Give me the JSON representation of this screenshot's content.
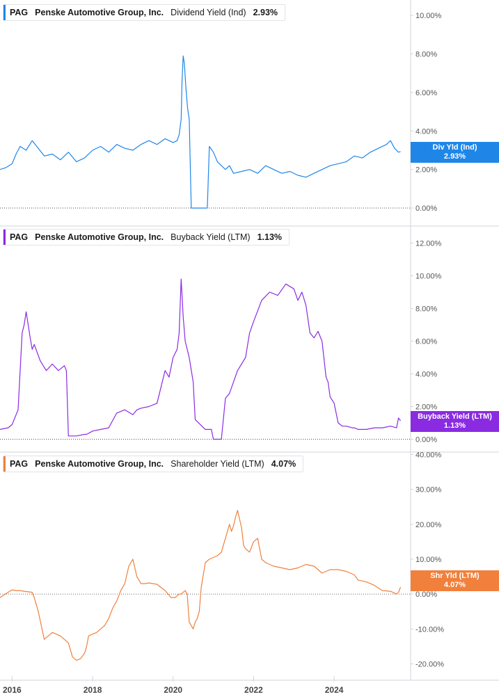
{
  "colors": {
    "dividend": "#1f86e8",
    "buyback": "#8a2be2",
    "shareholder": "#f0803c",
    "axis_text": "#555555",
    "divider": "#d0d3d9"
  },
  "x_axis": {
    "range": [
      2015.7,
      2025.9
    ],
    "ticks": [
      {
        "value": 2016,
        "label": "2016"
      },
      {
        "value": 2018,
        "label": "2018"
      },
      {
        "value": 2020,
        "label": "2020"
      },
      {
        "value": 2022,
        "label": "2022"
      },
      {
        "value": 2024,
        "label": "2024"
      }
    ]
  },
  "chart_data": [
    {
      "type": "line",
      "ticker": "PAG",
      "company": "Penske Automotive Group, Inc.",
      "metric": "Dividend Yield (Ind)",
      "current_value": "2.93%",
      "badge_label": "Div Yld (Ind)",
      "color": "#1f86e8",
      "ylim": [
        -0.9,
        10.8
      ],
      "y_ticks": [
        {
          "value": 0,
          "label": "0.00%"
        },
        {
          "value": 2,
          "label": "2.00%"
        },
        {
          "value": 4,
          "label": "4.00%"
        },
        {
          "value": 6,
          "label": "6.00%"
        },
        {
          "value": 8,
          "label": "8.00%"
        },
        {
          "value": 10,
          "label": "10.00%"
        }
      ],
      "x": [
        2015.7,
        2015.85,
        2016.0,
        2016.1,
        2016.2,
        2016.35,
        2016.5,
        2016.65,
        2016.8,
        2017.0,
        2017.2,
        2017.4,
        2017.6,
        2017.8,
        2018.0,
        2018.2,
        2018.4,
        2018.6,
        2018.8,
        2019.0,
        2019.2,
        2019.4,
        2019.6,
        2019.8,
        2020.0,
        2020.1,
        2020.15,
        2020.2,
        2020.22,
        2020.25,
        2020.28,
        2020.32,
        2020.36,
        2020.4,
        2020.45,
        2020.5,
        2020.55,
        2020.6,
        2020.65,
        2020.7,
        2020.75,
        2020.8,
        2020.85,
        2020.9,
        2021.0,
        2021.1,
        2021.2,
        2021.3,
        2021.4,
        2021.5,
        2021.7,
        2021.9,
        2022.1,
        2022.3,
        2022.5,
        2022.7,
        2022.9,
        2023.1,
        2023.3,
        2023.5,
        2023.7,
        2023.9,
        2024.1,
        2024.3,
        2024.5,
        2024.7,
        2024.9,
        2025.1,
        2025.3,
        2025.4,
        2025.5,
        2025.6,
        2025.65
      ],
      "y": [
        2.0,
        2.1,
        2.3,
        2.8,
        3.2,
        3.0,
        3.5,
        3.1,
        2.7,
        2.8,
        2.5,
        2.9,
        2.4,
        2.6,
        3.0,
        3.2,
        2.9,
        3.3,
        3.1,
        3.0,
        3.3,
        3.5,
        3.3,
        3.6,
        3.4,
        3.5,
        3.8,
        4.6,
        6.5,
        7.9,
        7.5,
        6.2,
        5.2,
        4.6,
        0.0,
        0.0,
        0.0,
        0.0,
        0.0,
        0.0,
        0.0,
        0.0,
        0.0,
        3.2,
        2.9,
        2.4,
        2.2,
        2.0,
        2.2,
        1.8,
        1.9,
        2.0,
        1.8,
        2.2,
        2.0,
        1.8,
        1.9,
        1.7,
        1.6,
        1.8,
        2.0,
        2.2,
        2.3,
        2.4,
        2.7,
        2.6,
        2.9,
        3.1,
        3.3,
        3.5,
        3.1,
        2.9,
        2.93
      ]
    },
    {
      "type": "line",
      "ticker": "PAG",
      "company": "Penske Automotive Group, Inc.",
      "metric": "Buyback Yield (LTM)",
      "current_value": "1.13%",
      "badge_label": "Buyback Yield (LTM)",
      "color": "#8a2be2",
      "ylim": [
        -0.7,
        13.0
      ],
      "y_ticks": [
        {
          "value": 0,
          "label": "0.00%"
        },
        {
          "value": 2,
          "label": "2.00%"
        },
        {
          "value": 4,
          "label": "4.00%"
        },
        {
          "value": 6,
          "label": "6.00%"
        },
        {
          "value": 8,
          "label": "8.00%"
        },
        {
          "value": 10,
          "label": "10.00%"
        },
        {
          "value": 12,
          "label": "12.00%"
        }
      ],
      "x": [
        2015.7,
        2015.9,
        2016.0,
        2016.1,
        2016.15,
        2016.25,
        2016.3,
        2016.35,
        2016.45,
        2016.5,
        2016.55,
        2016.7,
        2016.85,
        2017.0,
        2017.15,
        2017.3,
        2017.35,
        2017.4,
        2017.6,
        2017.8,
        2017.85,
        2018.0,
        2018.2,
        2018.4,
        2018.6,
        2018.8,
        2019.0,
        2019.1,
        2019.2,
        2019.4,
        2019.6,
        2019.8,
        2019.9,
        2020.0,
        2020.1,
        2020.15,
        2020.2,
        2020.25,
        2020.3,
        2020.4,
        2020.5,
        2020.55,
        2020.8,
        2020.9,
        2020.95,
        2021.0,
        2021.2,
        2021.3,
        2021.4,
        2021.5,
        2021.6,
        2021.8,
        2021.9,
        2022.0,
        2022.2,
        2022.4,
        2022.6,
        2022.8,
        2023.0,
        2023.1,
        2023.2,
        2023.3,
        2023.4,
        2023.5,
        2023.6,
        2023.7,
        2023.8,
        2023.85,
        2023.9,
        2024.0,
        2024.1,
        2024.2,
        2024.3,
        2024.45,
        2024.5,
        2024.6,
        2024.8,
        2025.0,
        2025.2,
        2025.4,
        2025.55,
        2025.6,
        2025.65
      ],
      "y": [
        0.6,
        0.7,
        0.9,
        1.5,
        1.8,
        6.5,
        7.0,
        7.8,
        6.2,
        5.5,
        5.8,
        4.8,
        4.2,
        4.6,
        4.2,
        4.5,
        4.2,
        0.2,
        0.2,
        0.3,
        0.3,
        0.5,
        0.6,
        0.7,
        1.6,
        1.8,
        1.5,
        1.8,
        1.9,
        2.0,
        2.2,
        4.2,
        3.8,
        5.0,
        5.5,
        6.5,
        9.8,
        7.5,
        6.0,
        5.0,
        3.5,
        1.2,
        0.6,
        0.6,
        0.6,
        0.0,
        0.0,
        2.5,
        2.8,
        3.5,
        4.2,
        5.0,
        6.5,
        7.2,
        8.5,
        9.0,
        8.8,
        9.5,
        9.2,
        8.5,
        9.0,
        8.2,
        6.5,
        6.2,
        6.6,
        6.0,
        3.8,
        3.5,
        2.6,
        2.2,
        1.0,
        0.8,
        0.8,
        0.7,
        0.7,
        0.6,
        0.6,
        0.7,
        0.7,
        0.8,
        0.7,
        1.3,
        1.13
      ]
    },
    {
      "type": "line",
      "ticker": "PAG",
      "company": "Penske Automotive Group, Inc.",
      "metric": "Shareholder Yield (LTM)",
      "current_value": "4.07%",
      "badge_label": "Shr Yld (LTM)",
      "color": "#f0803c",
      "ylim": [
        -23.5,
        40.5
      ],
      "y_ticks": [
        {
          "value": -20,
          "label": "-20.00%"
        },
        {
          "value": -10,
          "label": "-10.00%"
        },
        {
          "value": 0,
          "label": "0.00%"
        },
        {
          "value": 10,
          "label": "10.00%"
        },
        {
          "value": 20,
          "label": "20.00%"
        },
        {
          "value": 30,
          "label": "30.00%"
        },
        {
          "value": 40,
          "label": "40.00%"
        }
      ],
      "x": [
        2015.7,
        2015.9,
        2016.0,
        2016.1,
        2016.2,
        2016.3,
        2016.5,
        2016.55,
        2016.65,
        2016.8,
        2016.9,
        2017.0,
        2017.1,
        2017.2,
        2017.3,
        2017.4,
        2017.5,
        2017.6,
        2017.7,
        2017.8,
        2017.85,
        2017.9,
        2018.0,
        2018.1,
        2018.2,
        2018.3,
        2018.4,
        2018.5,
        2018.6,
        2018.7,
        2018.8,
        2018.9,
        2019.0,
        2019.1,
        2019.2,
        2019.3,
        2019.4,
        2019.5,
        2019.6,
        2019.8,
        2019.95,
        2020.0,
        2020.05,
        2020.1,
        2020.15,
        2020.2,
        2020.25,
        2020.3,
        2020.35,
        2020.4,
        2020.5,
        2020.55,
        2020.6,
        2020.65,
        2020.7,
        2020.8,
        2020.9,
        2021.0,
        2021.1,
        2021.2,
        2021.3,
        2021.4,
        2021.45,
        2021.5,
        2021.55,
        2021.6,
        2021.7,
        2021.75,
        2021.8,
        2021.9,
        2022.0,
        2022.1,
        2022.2,
        2022.3,
        2022.5,
        2022.7,
        2022.9,
        2023.1,
        2023.3,
        2023.5,
        2023.7,
        2023.9,
        2024.1,
        2024.3,
        2024.5,
        2024.6,
        2024.8,
        2025.0,
        2025.2,
        2025.4,
        2025.55,
        2025.6,
        2025.65
      ],
      "y": [
        -1.0,
        0.5,
        1.2,
        1.0,
        1.0,
        0.8,
        0.5,
        -1.0,
        -5.0,
        -13.0,
        -12.0,
        -11.0,
        -11.5,
        -12.0,
        -13.0,
        -14.0,
        -18.0,
        -19.0,
        -18.5,
        -17.0,
        -15.0,
        -12.0,
        -11.5,
        -11.0,
        -10.0,
        -9.0,
        -7.0,
        -4.0,
        -2.0,
        1.0,
        3.0,
        8.0,
        10.0,
        5.0,
        3.0,
        3.0,
        3.2,
        3.0,
        2.8,
        1.0,
        -1.0,
        -1.0,
        -1.0,
        -0.5,
        0.0,
        0.0,
        0.5,
        1.0,
        0.0,
        -8.0,
        -10.0,
        -8.0,
        -7.0,
        -5.0,
        2.0,
        9.0,
        10.0,
        10.5,
        11.0,
        12.0,
        16.0,
        20.0,
        18.0,
        19.5,
        22.0,
        24.0,
        19.0,
        14.0,
        13.0,
        12.0,
        15.0,
        16.0,
        10.0,
        9.0,
        8.0,
        7.5,
        7.0,
        7.5,
        8.5,
        8.0,
        6.0,
        7.0,
        7.0,
        6.5,
        5.5,
        4.0,
        3.5,
        2.5,
        1.0,
        0.8,
        0.0,
        0.5,
        2.0,
        4.2,
        4.07
      ]
    }
  ]
}
